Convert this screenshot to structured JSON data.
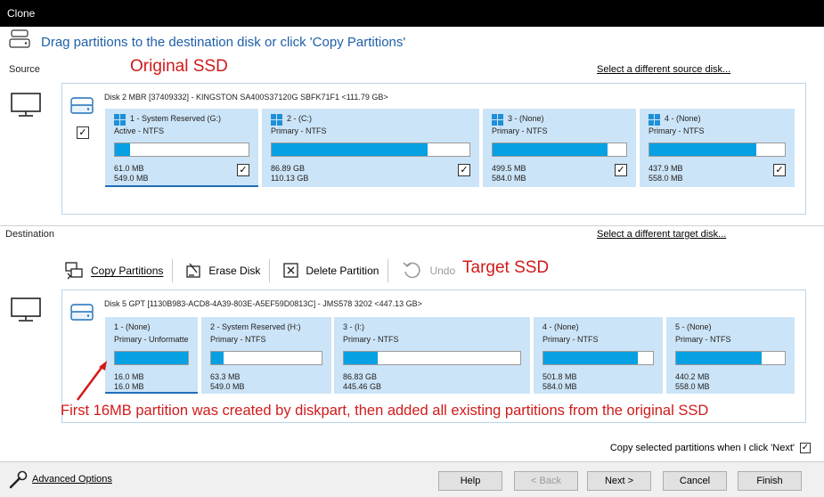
{
  "window": {
    "title": "Clone"
  },
  "header": {
    "text": "Drag partitions to the destination disk or click 'Copy Partitions'"
  },
  "source": {
    "label": "Source",
    "annotation": "Original SSD",
    "change_link": "Select a different source disk...",
    "disk_title": "Disk 2 MBR [37409332] - KINGSTON SA400S37120G SBFK71F1  <111.79 GB>",
    "partitions": [
      {
        "name": "1 - System Reserved (G:)",
        "type": "Active - NTFS",
        "used": "61.0 MB",
        "total": "549.0 MB",
        "fill": 0.11,
        "checked": true
      },
      {
        "name": "2 - (C:)",
        "type": "Primary - NTFS",
        "used": "86.89 GB",
        "total": "110.13 GB",
        "fill": 0.79,
        "checked": true
      },
      {
        "name": "3 - (None)",
        "type": "Primary - NTFS",
        "used": "499.5 MB",
        "total": "584.0 MB",
        "fill": 0.86,
        "checked": true
      },
      {
        "name": "4 - (None)",
        "type": "Primary - NTFS",
        "used": "437.9 MB",
        "total": "558.0 MB",
        "fill": 0.79,
        "checked": true
      }
    ]
  },
  "destination": {
    "label": "Destination",
    "change_link": "Select a different target disk...",
    "annotation": "Target SSD",
    "toolbar": {
      "copy": "Copy Partitions",
      "erase": "Erase Disk",
      "delete": "Delete Partition",
      "undo": "Undo"
    },
    "disk_title": "Disk 5 GPT [1130B983-ACD8-4A39-803E-A5EF59D0813C] - JMS578   3202  <447.13 GB>",
    "partitions": [
      {
        "name": "1 - (None)",
        "type": "Primary - Unformatte",
        "used": "16.0 MB",
        "total": "16.0 MB",
        "fill": 1.0
      },
      {
        "name": "2 - System Reserved (H:)",
        "type": "Primary - NTFS",
        "used": "63.3 MB",
        "total": "549.0 MB",
        "fill": 0.11
      },
      {
        "name": "3 - (I:)",
        "type": "Primary - NTFS",
        "used": "86.83 GB",
        "total": "445.46 GB",
        "fill": 0.19
      },
      {
        "name": "4 - (None)",
        "type": "Primary - NTFS",
        "used": "501.8 MB",
        "total": "584.0 MB",
        "fill": 0.86
      },
      {
        "name": "5 - (None)",
        "type": "Primary - NTFS",
        "used": "440.2 MB",
        "total": "558.0 MB",
        "fill": 0.79
      }
    ],
    "note": "First 16MB partition was created by diskpart, then added all existing partitions from the original SSD"
  },
  "options": {
    "copy_selected": "Copy selected partitions when I click 'Next'",
    "copy_selected_checked": true
  },
  "footer": {
    "advanced": "Advanced Options",
    "help": "Help",
    "back": "< Back",
    "next": "Next >",
    "cancel": "Cancel",
    "finish": "Finish"
  },
  "colors": {
    "accent": "#06a0e3",
    "partition_bg": "#cce4f7",
    "annotation": "#d11a1a",
    "header": "#1f5fa8"
  }
}
